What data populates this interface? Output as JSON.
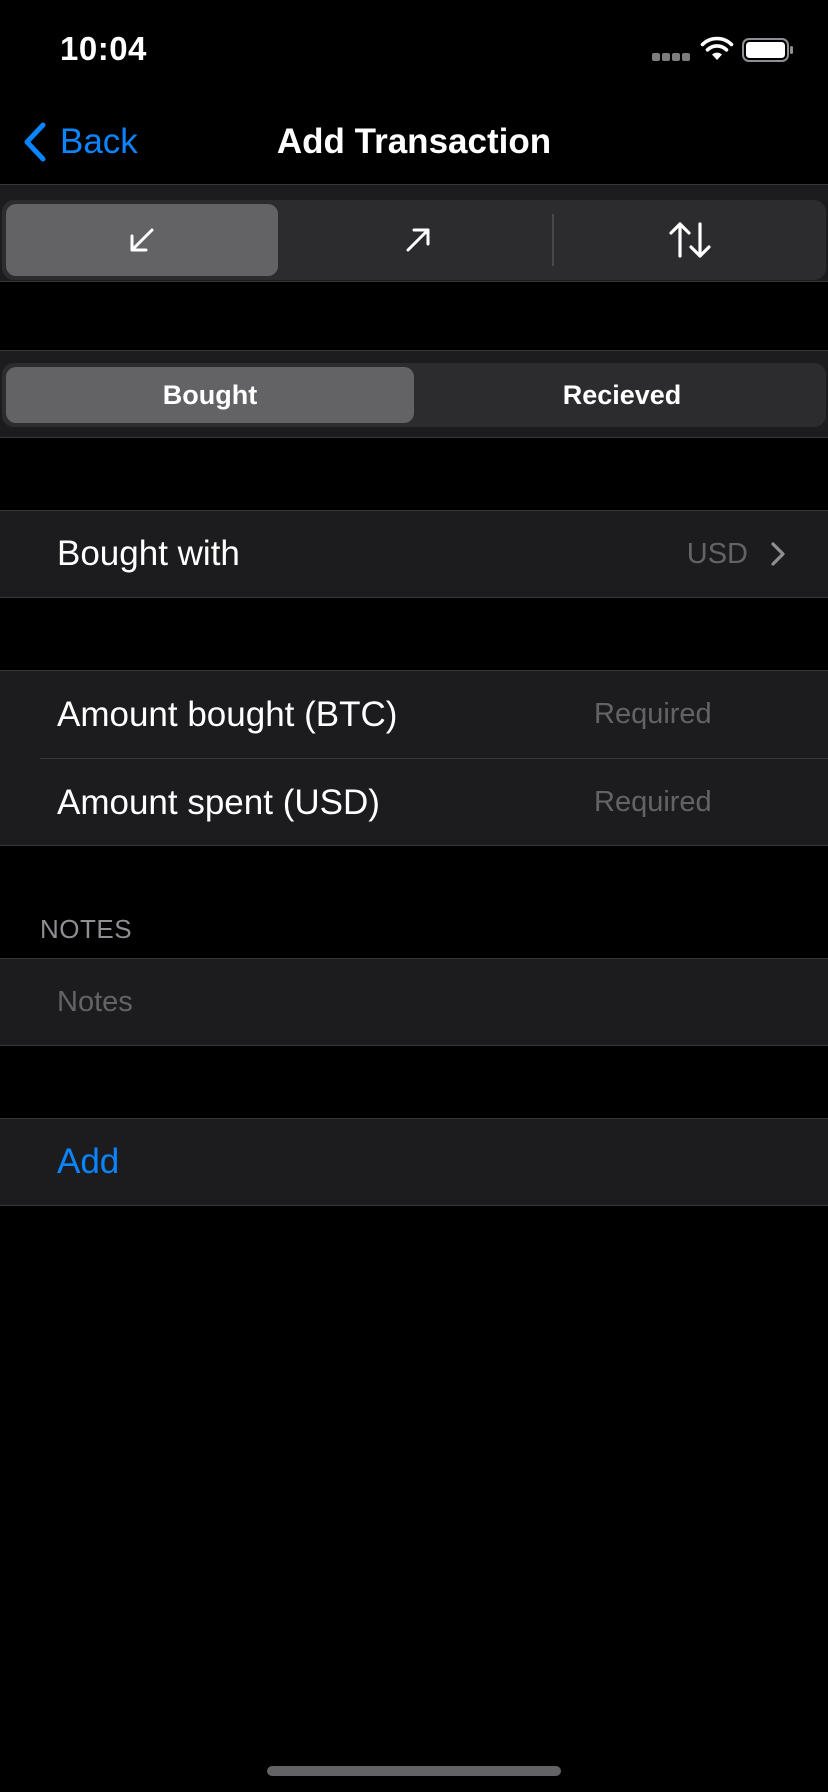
{
  "status_bar": {
    "time": "10:04"
  },
  "nav": {
    "back_label": "Back",
    "title": "Add Transaction"
  },
  "type_selector": {
    "options": [
      {
        "icon": "arrow-down-left-icon",
        "selected": true
      },
      {
        "icon": "arrow-up-right-icon",
        "selected": false
      },
      {
        "icon": "arrows-up-down-icon",
        "selected": false
      }
    ]
  },
  "mode_selector": {
    "options": [
      {
        "label": "Bought",
        "selected": true
      },
      {
        "label": "Recieved",
        "selected": false
      }
    ]
  },
  "bought_with": {
    "label": "Bought with",
    "value": "USD"
  },
  "amounts": {
    "bought_label": "Amount bought (BTC)",
    "bought_placeholder": "Required",
    "spent_label": "Amount spent (USD)",
    "spent_placeholder": "Required"
  },
  "notes": {
    "header": "NOTES",
    "placeholder": "Notes"
  },
  "actions": {
    "add_label": "Add"
  },
  "colors": {
    "accent": "#0a84ff",
    "background": "#000000",
    "cell_background": "#1c1c1e",
    "segment_background": "#2c2c2e",
    "segment_selected": "#636366",
    "placeholder_text": "#636366"
  }
}
